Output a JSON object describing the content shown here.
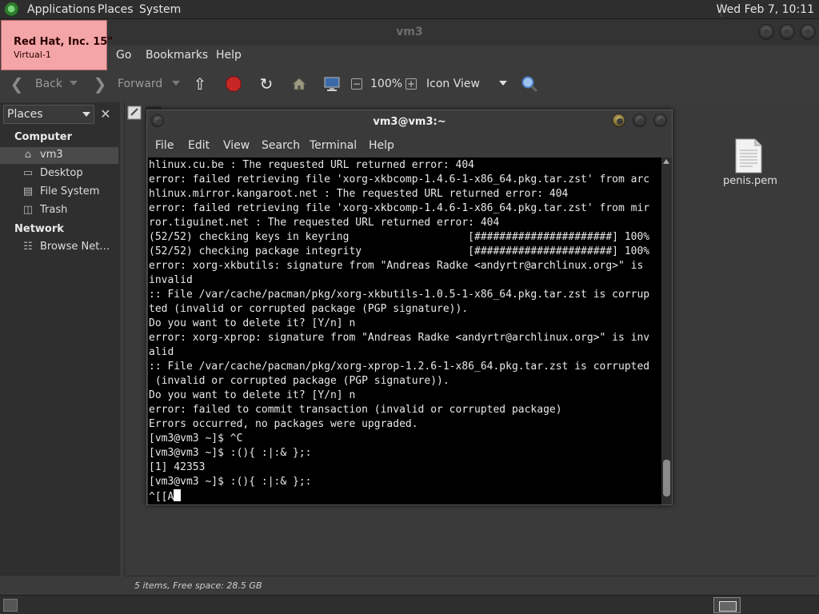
{
  "top_panel": {
    "menus": [
      "Applications",
      "Places",
      "System"
    ],
    "clock": "Wed Feb  7, 10:11"
  },
  "osd": {
    "title": "Red Hat, Inc. 15\"",
    "subtitle": "Virtual-1"
  },
  "file_manager": {
    "title": "vm3",
    "menus": [
      "Go",
      "Bookmarks",
      "Help"
    ],
    "toolbar": {
      "back": "Back",
      "forward": "Forward",
      "zoom": "100%",
      "view_mode": "Icon View"
    },
    "sidebar": {
      "combo": "Places",
      "sections": [
        {
          "heading": "Computer",
          "items": [
            {
              "label": "vm3",
              "icon": "home-icon"
            },
            {
              "label": "Desktop",
              "icon": "desktop-icon"
            },
            {
              "label": "File System",
              "icon": "drive-icon"
            },
            {
              "label": "Trash",
              "icon": "trash-icon"
            }
          ]
        },
        {
          "heading": "Network",
          "items": [
            {
              "label": "Browse Net…",
              "icon": "network-icon"
            }
          ]
        }
      ]
    },
    "files": [
      {
        "name": "penis.pem",
        "icon": "text-file-icon"
      }
    ],
    "status": "5 items, Free space: 28.5 GB"
  },
  "terminal": {
    "title": "vm3@vm3:~",
    "menus": [
      "File",
      "Edit",
      "View",
      "Search",
      "Terminal",
      "Help"
    ],
    "lines": [
      "hlinux.cu.be : The requested URL returned error: 404",
      "error: failed retrieving file 'xorg-xkbcomp-1.4.6-1-x86_64.pkg.tar.zst' from arc",
      "hlinux.mirror.kangaroot.net : The requested URL returned error: 404",
      "error: failed retrieving file 'xorg-xkbcomp-1.4.6-1-x86_64.pkg.tar.zst' from mir",
      "ror.tiguinet.net : The requested URL returned error: 404",
      "(52/52) checking keys in keyring                   [######################] 100%",
      "(52/52) checking package integrity                 [######################] 100%",
      "error: xorg-xkbutils: signature from \"Andreas Radke <andyrtr@archlinux.org>\" is",
      "invalid",
      ":: File /var/cache/pacman/pkg/xorg-xkbutils-1.0.5-1-x86_64.pkg.tar.zst is corrup",
      "ted (invalid or corrupted package (PGP signature)).",
      "Do you want to delete it? [Y/n] n",
      "error: xorg-xprop: signature from \"Andreas Radke <andyrtr@archlinux.org>\" is inv",
      "alid",
      ":: File /var/cache/pacman/pkg/xorg-xprop-1.2.6-1-x86_64.pkg.tar.zst is corrupted",
      " (invalid or corrupted package (PGP signature)).",
      "Do you want to delete it? [Y/n] n",
      "error: failed to commit transaction (invalid or corrupted package)",
      "Errors occurred, no packages were upgraded.",
      "[vm3@vm3 ~]$ ^C",
      "[vm3@vm3 ~]$ :(){ :|:& };:",
      "[1] 42353",
      "[vm3@vm3 ~]$ :(){ :|:& };:"
    ],
    "input_line": "^[[A"
  }
}
